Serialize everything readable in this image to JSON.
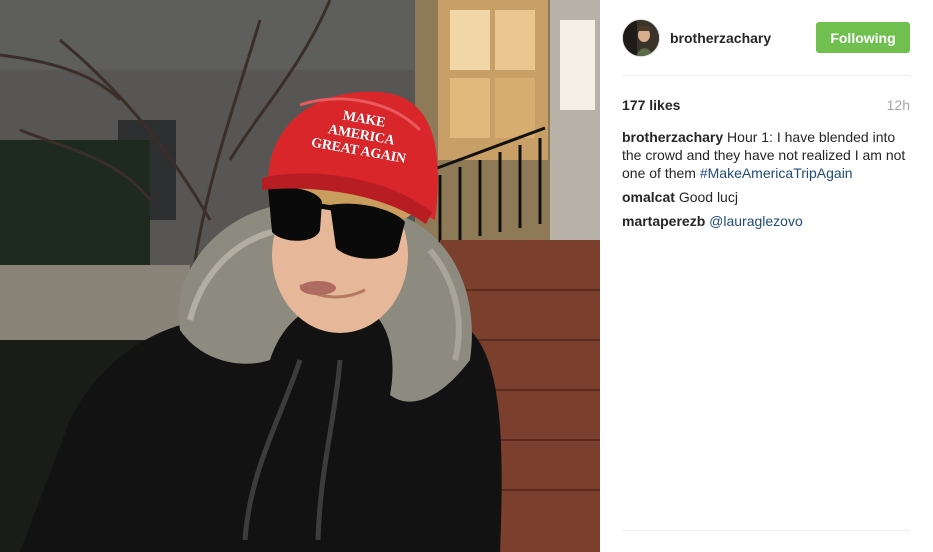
{
  "photo": {
    "hat_lines": [
      "MAKE AMERICA",
      "GREAT AGAIN"
    ]
  },
  "header": {
    "username": "brotherzachary",
    "follow_label": "Following",
    "avatar_icon": "profile-photo"
  },
  "stats": {
    "likes": "177 likes",
    "time": "12h"
  },
  "caption": {
    "author": "brotherzachary",
    "text": "Hour 1: I have blended into the crowd and they have not realized I am not one of them",
    "hashtag": "#MakeAmericaTripAgain"
  },
  "comments": [
    {
      "author": "omalcat",
      "text": "Good lucj"
    },
    {
      "author": "martaperezb",
      "mention": "@lauraglezovo"
    }
  ],
  "colors": {
    "follow_button": "#70c050",
    "link": "#1f4b79",
    "muted": "#a5a7aa"
  }
}
